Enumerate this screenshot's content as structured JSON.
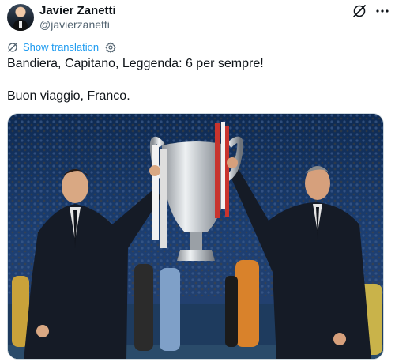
{
  "author": {
    "name": "Javier Zanetti",
    "handle": "@javierzanetti"
  },
  "icons": {
    "grok": "grok-icon",
    "more": "more-icon",
    "translate": "globe-icon",
    "settings": "gear-icon"
  },
  "translate": {
    "link_label": "Show translation"
  },
  "tweet": {
    "line1": "Bandiera, Capitano, Leggenda: 6 per sempre!",
    "line2": "Buon viaggio, Franco."
  },
  "colors": {
    "link": "#1d9bf0",
    "secondary_text": "#536471",
    "text": "#0f1419"
  }
}
